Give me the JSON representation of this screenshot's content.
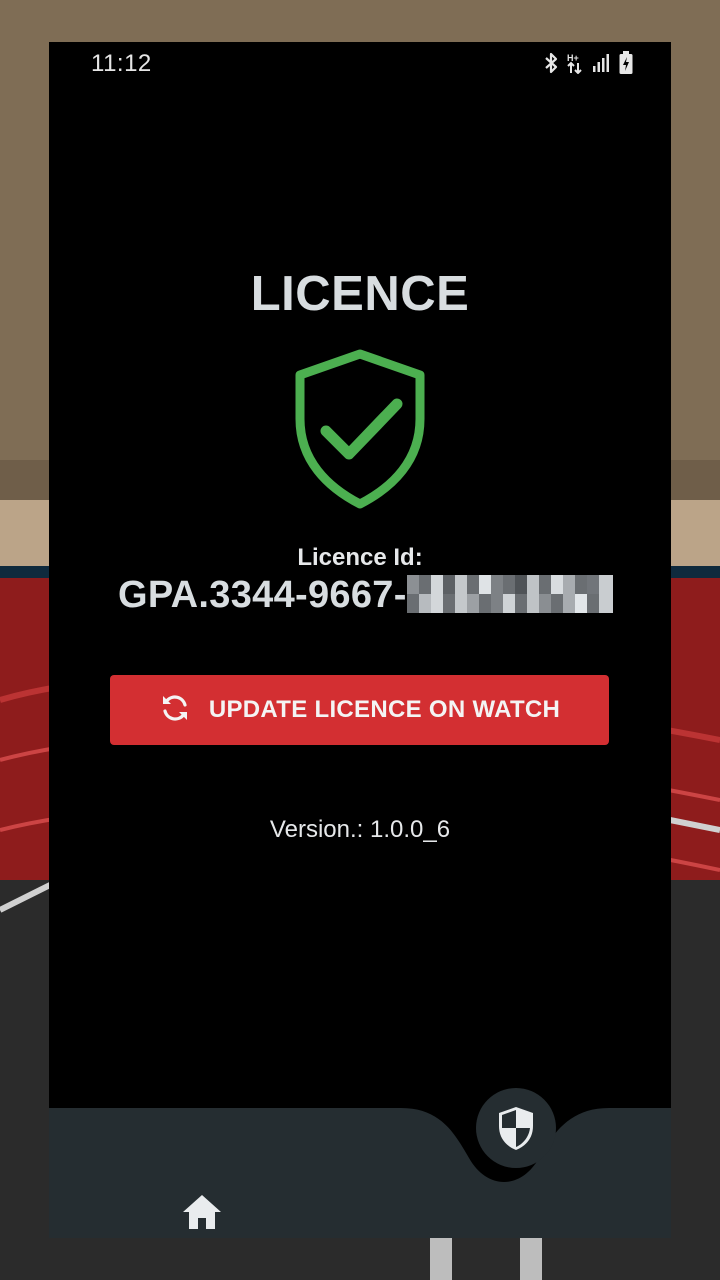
{
  "status_bar": {
    "time": "11:12",
    "icons": [
      "bluetooth-icon",
      "data-arrows-icon",
      "signal-icon",
      "battery-charging-icon"
    ]
  },
  "screen": {
    "title": "LICENCE",
    "status_icon": "shield-check-icon",
    "status_color": "#4caf50",
    "licence_id_label": "Licence Id:",
    "licence_id_visible": "GPA.3344-9667-",
    "licence_id_redacted": true
  },
  "actions": {
    "update_button": {
      "label": "UPDATE LICENCE ON WATCH",
      "icon": "sync-icon",
      "color": "#d32f32"
    }
  },
  "version_text": "Version.: 1.0.0_6",
  "bottom_nav": {
    "items": [
      {
        "icon": "home-icon",
        "active": false
      },
      {
        "icon": "shield-half-icon",
        "active": true
      }
    ],
    "background": "#252d31"
  }
}
